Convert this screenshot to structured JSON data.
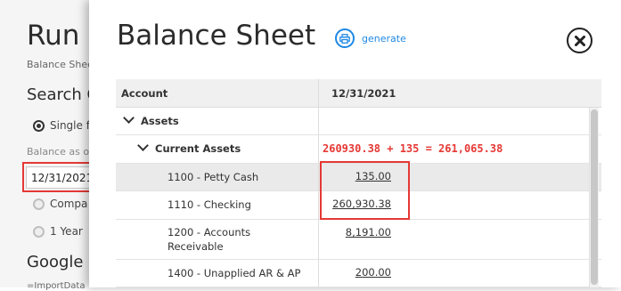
{
  "background": {
    "title": "Run",
    "subtitle": "Balance Shee",
    "search_heading": "Search C",
    "radio_single_label": "Single f",
    "balance_as_of_label": "Balance as o",
    "date_value": "12/31/2021",
    "radio_compare_label": "Compa",
    "radio_year_label": "1 Year",
    "google_heading": "Google F",
    "import_text": "=ImportData"
  },
  "modal": {
    "title": "Balance Sheet",
    "generate_label": "generate",
    "columns": {
      "account": "Account",
      "date": "12/31/2021"
    },
    "annotation": "260930.38 + 135 = 261,065.38",
    "rows": [
      {
        "label": "Assets",
        "value": ""
      },
      {
        "label": "Current Assets",
        "value": ""
      },
      {
        "label": "1100 - Petty Cash",
        "value": "135.00"
      },
      {
        "label": "1110 - Checking",
        "value": "260,930.38"
      },
      {
        "label": "1200 - Accounts Receivable",
        "value": "8,191.00"
      },
      {
        "label": "1400 - Unapplied AR & AP",
        "value": "200.00"
      }
    ]
  },
  "colors": {
    "accent": "#1e88e5",
    "annotation": "#e53935",
    "highlight_row": "#eaeaea"
  }
}
